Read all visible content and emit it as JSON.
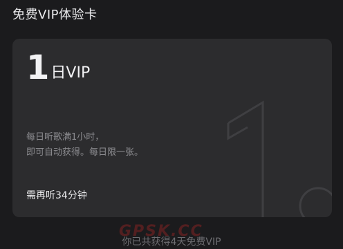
{
  "header": {
    "title": "免费VIP体验卡"
  },
  "card": {
    "title_number": "1",
    "title_unit": "日VIP",
    "description_line1": "每日听歌满1小时，",
    "description_line2": "即可自动获得。每日限一张。",
    "remaining": "需再听34分钟",
    "watermark_icon": "large-number-one-outline"
  },
  "footer": {
    "summary": "你已共获得4天免费VIP"
  },
  "watermark": {
    "text": "GPSK.CC"
  },
  "colors": {
    "background": "#1b1b1d",
    "card": "#2c2c2e",
    "primary_text": "#ececee",
    "secondary_text": "#8c8c90"
  }
}
